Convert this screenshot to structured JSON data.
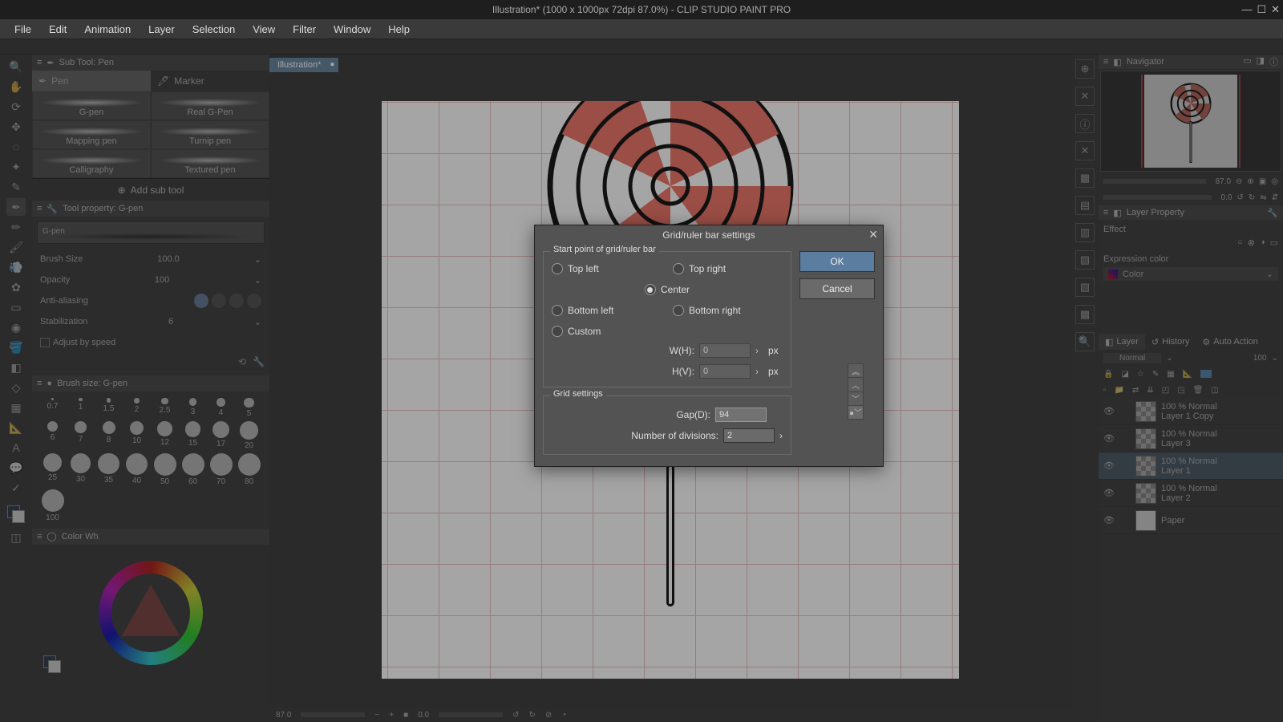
{
  "title": "Illustration* (1000 x 1000px 72dpi 87.0%)   -   CLIP STUDIO PAINT PRO",
  "menu": [
    "File",
    "Edit",
    "Animation",
    "Layer",
    "Selection",
    "View",
    "Filter",
    "Window",
    "Help"
  ],
  "doc_tab": "Illustration*",
  "subtool": {
    "title": "Sub Tool: Pen",
    "tabs": [
      "Pen",
      "Marker"
    ],
    "items": [
      "G-pen",
      "Real G-Pen",
      "Mapping pen",
      "Turnip pen",
      "Calligraphy",
      "Textured pen"
    ],
    "add": "Add sub tool"
  },
  "toolprop": {
    "title": "Tool property: G-pen",
    "name": "G-pen",
    "rows": {
      "brush_size": "Brush Size",
      "brush_size_val": "100.0",
      "opacity": "Opacity",
      "opacity_val": "100",
      "aa": "Anti-aliasing",
      "stab": "Stabilization",
      "stab_val": "6",
      "adjust": "Adjust by speed"
    }
  },
  "brushsize": {
    "title": "Brush size: G-pen",
    "sizes": [
      "0.7",
      "1",
      "1.5",
      "2",
      "2.5",
      "3",
      "4",
      "5",
      "6",
      "7",
      "8",
      "10",
      "12",
      "15",
      "17",
      "20",
      "25",
      "30",
      "35",
      "40",
      "50",
      "60",
      "70",
      "80",
      "100"
    ]
  },
  "colorwheel_title": "Color Wh",
  "navigator": {
    "title": "Navigator",
    "zoom": "87.0",
    "rot": "0.0"
  },
  "layerprop": {
    "title": "Layer Property",
    "effect": "Effect",
    "expr": "Expression color",
    "mode": "Color"
  },
  "layers": {
    "tabs": [
      "Layer",
      "History",
      "Auto Action"
    ],
    "blend": "Normal",
    "opacity": "100",
    "list": [
      {
        "name": "Layer 1 Copy",
        "info": "100 % Normal"
      },
      {
        "name": "Layer 3",
        "info": "100 % Normal"
      },
      {
        "name": "Layer 1",
        "info": "100 % Normal",
        "selected": true
      },
      {
        "name": "Layer 2",
        "info": "100 % Normal"
      },
      {
        "name": "Paper",
        "info": "",
        "paper": true
      }
    ]
  },
  "status": {
    "zoom": "87.0",
    "rot": "0.0"
  },
  "dialog": {
    "title": "Grid/ruler bar settings",
    "group1": "Start point of grid/ruler bar",
    "opts": {
      "tl": "Top left",
      "tr": "Top right",
      "c": "Center",
      "bl": "Bottom left",
      "br": "Bottom right",
      "cu": "Custom"
    },
    "wh": "W(H):",
    "hv": "H(V):",
    "px": "px",
    "wh_val": "0",
    "hv_val": "0",
    "group2": "Grid settings",
    "gap": "Gap(D):",
    "gap_val": "94",
    "div": "Number of divisions:",
    "div_val": "2",
    "ok": "OK",
    "cancel": "Cancel"
  }
}
